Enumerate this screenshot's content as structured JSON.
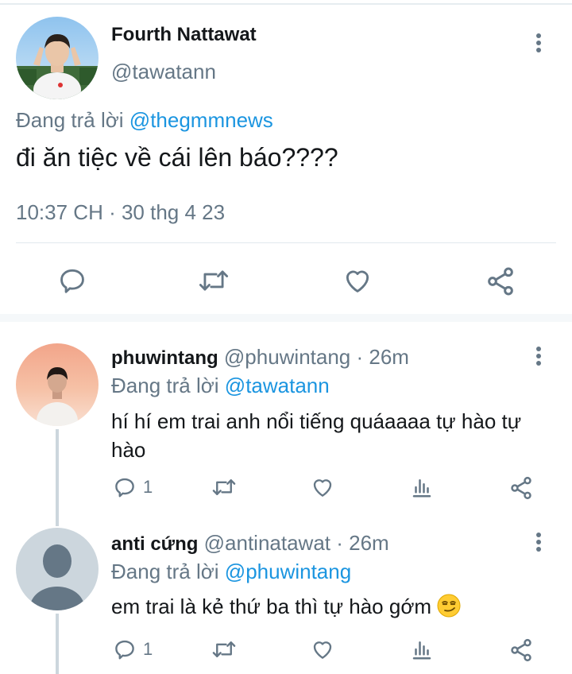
{
  "main_tweet": {
    "display_name": "Fourth Nattawat",
    "handle": "@tawatann",
    "replying_prefix": "Đang trả lời",
    "replying_to": "@thegmmnews",
    "text": "đi ăn tiệc về cái lên báo????",
    "timestamp": "10:37 CH · 30 thg 4 23"
  },
  "replies": [
    {
      "display_name": "phuwintang",
      "handle": "@phuwintang",
      "time": "· 26m",
      "replying_prefix": "Đang trả lời",
      "replying_to": "@tawatann",
      "text": "hí hí em trai anh nổi tiếng quáaaaa tự hào tự hào",
      "reply_count": "1"
    },
    {
      "display_name": "anti cứng",
      "handle": "@antinatawat",
      "time": "· 26m",
      "replying_prefix": "Đang trả lời",
      "replying_to": "@phuwintang",
      "text": "em trai là kẻ thứ ba thì tự hào gớm",
      "emoji": "smirking-face",
      "reply_count": "1"
    }
  ],
  "colors": {
    "accent": "#1b95e0",
    "muted": "#657786",
    "text": "#14171a"
  },
  "icons": [
    "more-vert-icon",
    "reply-icon",
    "retweet-icon",
    "like-icon",
    "share-icon",
    "analytics-icon"
  ]
}
